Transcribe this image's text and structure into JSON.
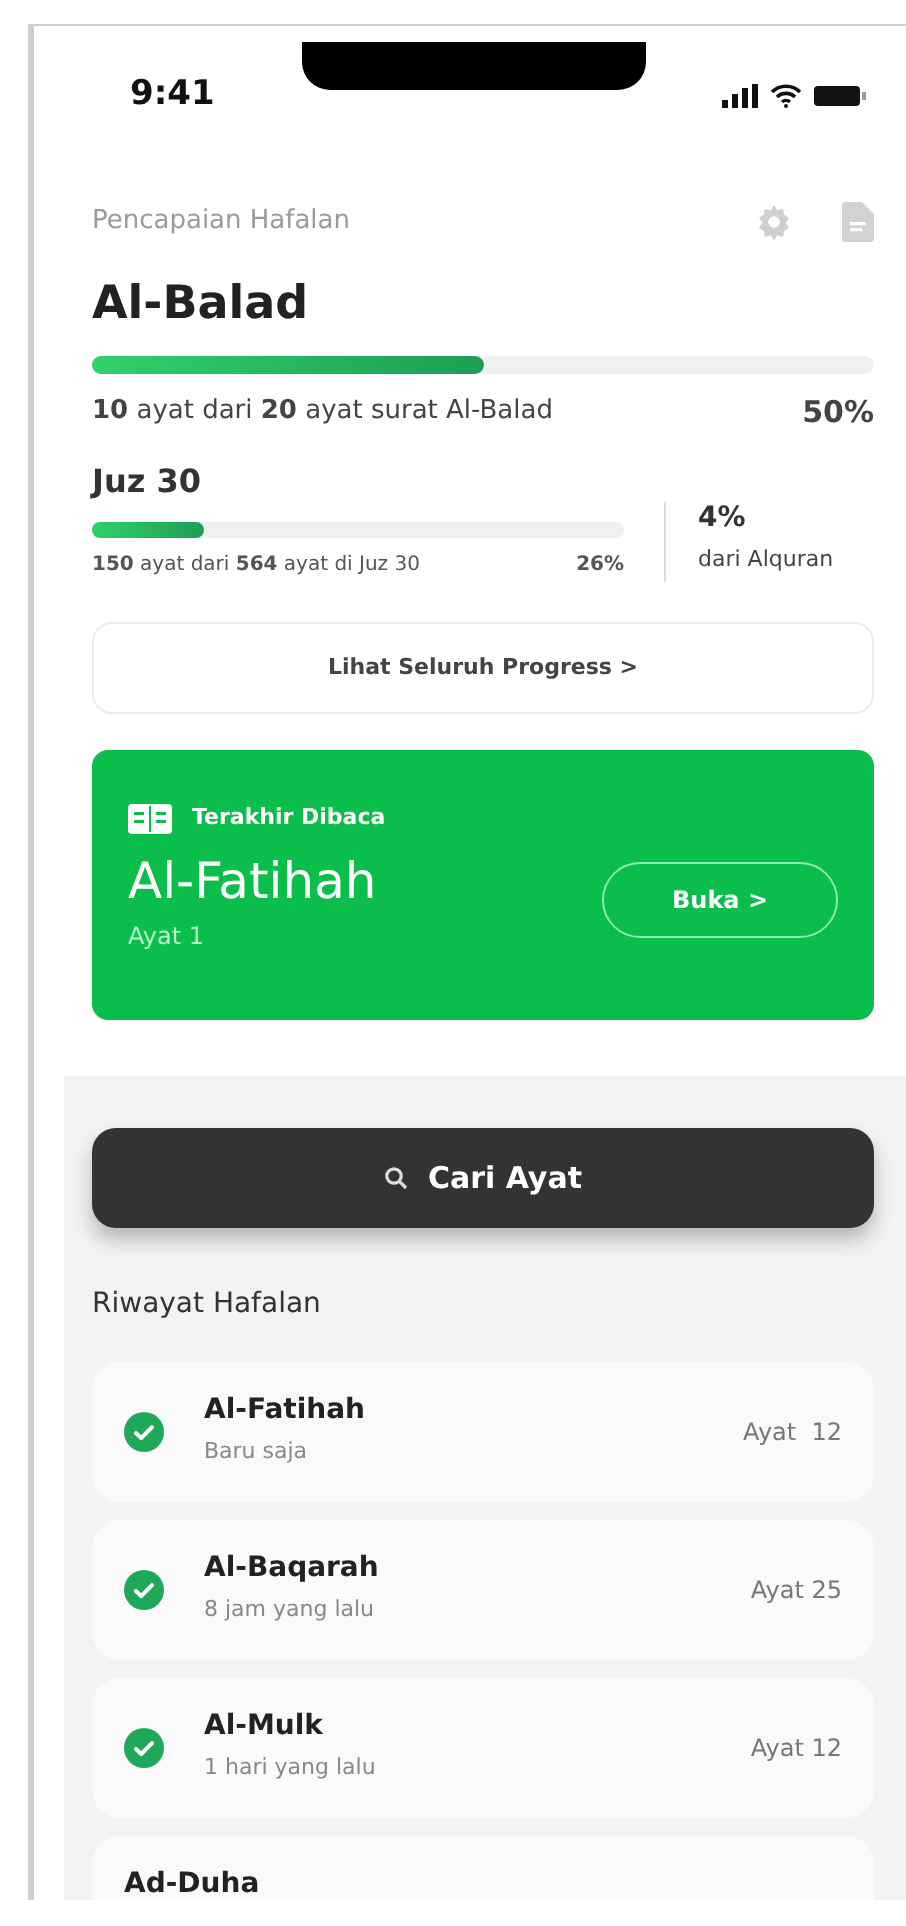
{
  "status_bar": {
    "time": "9:41"
  },
  "header": {
    "title": "Pencapaian Hafalan"
  },
  "surah_progress": {
    "name": "Al-Balad",
    "level": 0.5,
    "summary": "**10** ayat dari **20** ayat surat Al-Balad",
    "percent": "50%"
  },
  "juz_progress": {
    "name": "Juz 30",
    "level": 0.21,
    "summary": "**150** ayat dari **564** ayat di Juz 30",
    "percent": "26%",
    "quran_percent": "4%",
    "quran_label": "dari Alquran"
  },
  "progress_button": "Lihat Seluruh Progress >",
  "last_read": {
    "label": "Terakhir Dibaca",
    "surah": "Al-Fatihah",
    "ayah": "Ayat 1",
    "button": "Buka >"
  },
  "search_button": "Cari Ayat",
  "history": {
    "title": "Riwayat Hafalan",
    "items": [
      {
        "surah": "Al-Fatihah",
        "time": "Baru saja",
        "ayah": "Ayat  12",
        "done": true
      },
      {
        "surah": "Al-Baqarah",
        "time": "8 jam yang lalu",
        "ayah": "Ayat 25",
        "done": true
      },
      {
        "surah": "Al-Mulk",
        "time": "1 hari yang lalu",
        "ayah": "Ayat 12",
        "done": true
      },
      {
        "surah": "Ad-Duha",
        "done": false
      }
    ]
  }
}
